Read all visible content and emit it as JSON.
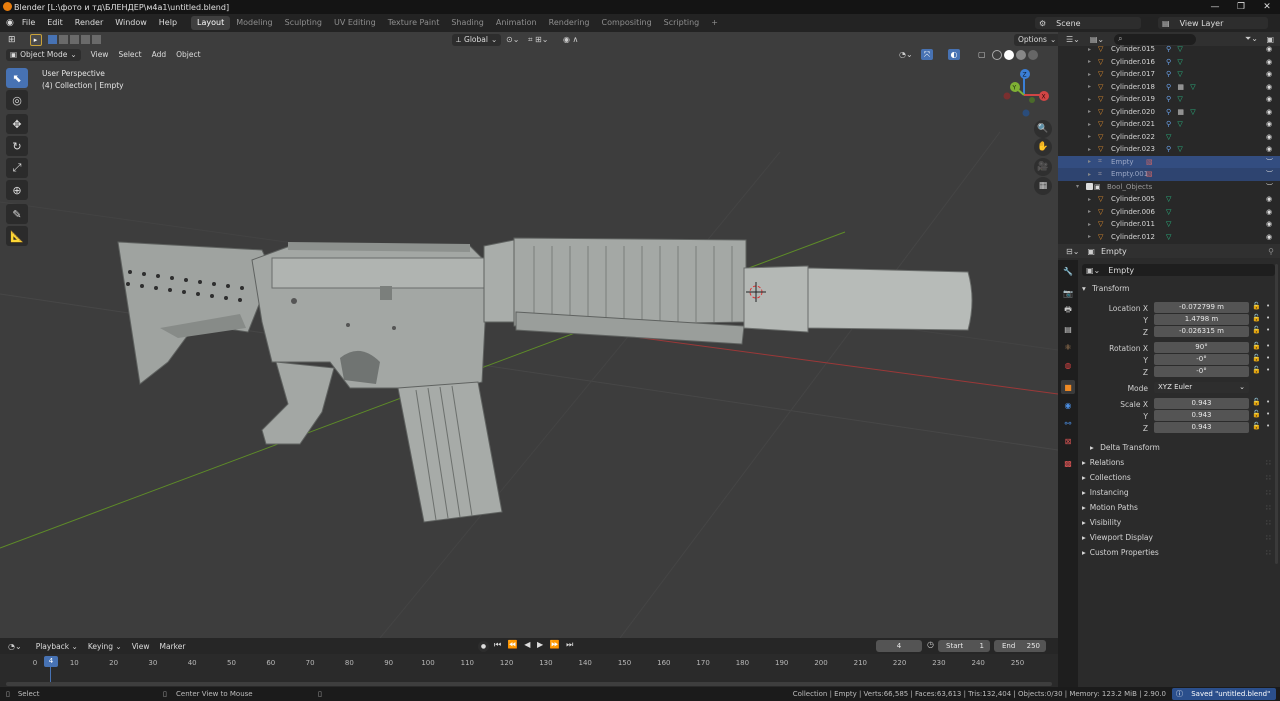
{
  "window": {
    "title": "Blender [L:\\фото и тд\\БЛЕНДЕР\\м4а1\\untitled.blend]",
    "controls": [
      "—",
      "❐",
      "✕"
    ]
  },
  "menu": {
    "items": [
      "File",
      "Edit",
      "Render",
      "Window",
      "Help"
    ],
    "workspaces": [
      "Layout",
      "Modeling",
      "Sculpting",
      "UV Editing",
      "Texture Paint",
      "Shading",
      "Animation",
      "Rendering",
      "Compositing",
      "Scripting"
    ],
    "active_workspace": "Layout",
    "add_tab": "+",
    "scene": "Scene",
    "view_layer": "View Layer"
  },
  "viewport": {
    "transform_orientation": "Global",
    "options_label": "Options",
    "mode": "Object Mode",
    "header_menus": [
      "View",
      "Select",
      "Add",
      "Object"
    ],
    "perspective": "User Perspective",
    "collection_info": "(4) Collection | Empty",
    "gizmo_axes": {
      "x": "X",
      "y": "Y",
      "z": "Z"
    },
    "colors": {
      "background": "#3d3d3d",
      "x_axis": "#b03a3a",
      "y_axis": "#6a9a2a",
      "model": "#9fa3a0"
    }
  },
  "outliner": {
    "search_placeholder": "",
    "rows": [
      {
        "name": "Cylinder.015",
        "type": "mesh",
        "mods": 2
      },
      {
        "name": "Cylinder.016",
        "type": "mesh",
        "mods": 2
      },
      {
        "name": "Cylinder.017",
        "type": "mesh",
        "mods": 2
      },
      {
        "name": "Cylinder.018",
        "type": "mesh",
        "mods": 3
      },
      {
        "name": "Cylinder.019",
        "type": "mesh",
        "mods": 2
      },
      {
        "name": "Cylinder.020",
        "type": "mesh",
        "mods": 3
      },
      {
        "name": "Cylinder.021",
        "type": "mesh",
        "mods": 2
      },
      {
        "name": "Cylinder.022",
        "type": "mesh",
        "mods": 1
      },
      {
        "name": "Cylinder.023",
        "type": "mesh",
        "mods": 2
      },
      {
        "name": "Empty",
        "type": "empty",
        "selected": true
      },
      {
        "name": "Empty.001",
        "type": "empty",
        "selected": true
      },
      {
        "name": "Bool_Objects",
        "type": "collection"
      },
      {
        "name": "Cylinder.005",
        "type": "mesh",
        "mods": 1
      },
      {
        "name": "Cylinder.006",
        "type": "mesh",
        "mods": 1
      },
      {
        "name": "Cylinder.011",
        "type": "mesh",
        "mods": 1
      },
      {
        "name": "Cylinder.012",
        "type": "mesh",
        "mods": 1
      }
    ]
  },
  "properties": {
    "context_object": "Empty",
    "object_name": "Empty",
    "transform_header": "Transform",
    "location": {
      "label": "Location X",
      "x": "-0.072799 m",
      "y": "1.4798 m",
      "z": "-0.026315 m"
    },
    "rotation": {
      "label": "Rotation X",
      "x": "90°",
      "y": "-0°",
      "z": "-0°"
    },
    "axis_labels": {
      "y": "Y",
      "z": "Z"
    },
    "mode_label": "Mode",
    "mode_value": "XYZ Euler",
    "scale": {
      "label": "Scale X",
      "x": "0.943",
      "y": "0.943",
      "z": "0.943"
    },
    "delta_transform": "Delta Transform",
    "sections": [
      "Relations",
      "Collections",
      "Instancing",
      "Motion Paths",
      "Visibility",
      "Viewport Display",
      "Custom Properties"
    ]
  },
  "timeline": {
    "menus": [
      "Playback",
      "Keying",
      "View",
      "Marker"
    ],
    "current_frame": "4",
    "start_label": "Start",
    "start_value": "1",
    "end_label": "End",
    "end_value": "250",
    "ticks": [
      "0",
      "10",
      "20",
      "30",
      "40",
      "50",
      "60",
      "70",
      "80",
      "90",
      "100",
      "110",
      "120",
      "130",
      "140",
      "150",
      "160",
      "170",
      "180",
      "190",
      "200",
      "210",
      "220",
      "230",
      "240",
      "250"
    ],
    "playhead": "4"
  },
  "status": {
    "left": "Select",
    "middle": "Center View to Mouse",
    "stats": "Collection | Empty | Verts:66,585 | Faces:63,613 | Tris:132,404 | Objects:0/30 | Memory: 123.2 MiB | 2.90.0",
    "saved": "Saved \"untitled.blend\""
  }
}
